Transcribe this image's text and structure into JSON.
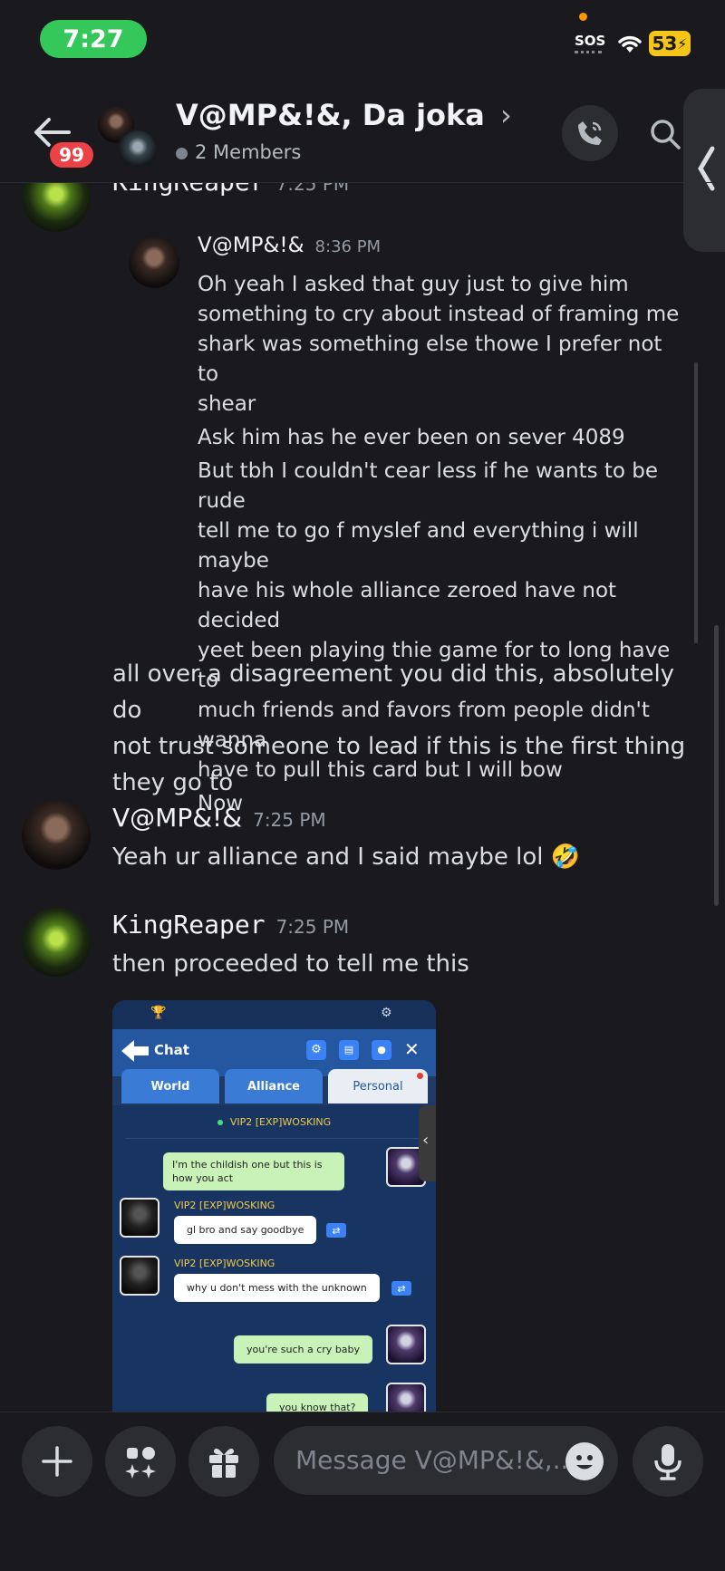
{
  "status_bar": {
    "time": "7:27",
    "sos": "SOS",
    "battery": "53"
  },
  "header": {
    "unread_count": "99",
    "title": "V@MP&!&, Da joka",
    "members": "2 Members"
  },
  "messages": {
    "partial_top": {
      "author": "KingReaper",
      "time": "7:25 PM"
    },
    "reply": {
      "author": "V@MP&!&",
      "time": "8:36 PM",
      "lines": [
        "Oh yeah I asked that guy just to give him",
        "something to cry about instead of framing me",
        "shark was something else thowe I prefer not to",
        "shear"
      ],
      "line2": "Ask him has he ever been on sever 4089",
      "para3": [
        "But tbh I couldn't cear less if he wants to be rude",
        "tell me to go f myslef and everything i will maybe",
        "have his whole alliance zeroed have not decided",
        "yeet been playing thie game for to long have to",
        "much friends and favors from people didn't wanna",
        "have to pull this card but I will bow"
      ],
      "line4": "Now"
    },
    "continuation": {
      "lines": [
        "all over a disagreement you did this, absolutely do",
        "not trust someone to lead if this is the first thing",
        "they go to"
      ]
    },
    "vamp": {
      "author": "V@MP&!&",
      "time": "7:25 PM",
      "text": "Yeah ur alliance and I said maybe lol 🤣"
    },
    "king": {
      "author": "KingReaper",
      "time": "7:25 PM",
      "text": "then proceeded to tell me this"
    }
  },
  "attachment": {
    "header_title": "Chat",
    "tabs": [
      "World",
      "Alliance",
      "Personal"
    ],
    "online_user": "VIP2 [EXP]WOSKING",
    "chat": [
      {
        "side": "right",
        "text": "I'm the childish one but this is how you act"
      },
      {
        "side": "left",
        "tag": "VIP2 [EXP]WOSKING",
        "text": "gl bro and say goodbye"
      },
      {
        "side": "left",
        "tag": "VIP2 [EXP]WOSKING",
        "text": "why u don't mess with the unknown"
      },
      {
        "side": "right",
        "text": "you're such a cry baby"
      },
      {
        "side": "right",
        "text": "you know that?"
      }
    ]
  },
  "composer": {
    "placeholder": "Message V@MP&!&,..."
  },
  "colors": {
    "background": "#1a1a1e",
    "surface": "#2b2d31",
    "badge_red": "#ed4245",
    "time_green": "#34c759",
    "battery_yellow": "#f5c518"
  }
}
